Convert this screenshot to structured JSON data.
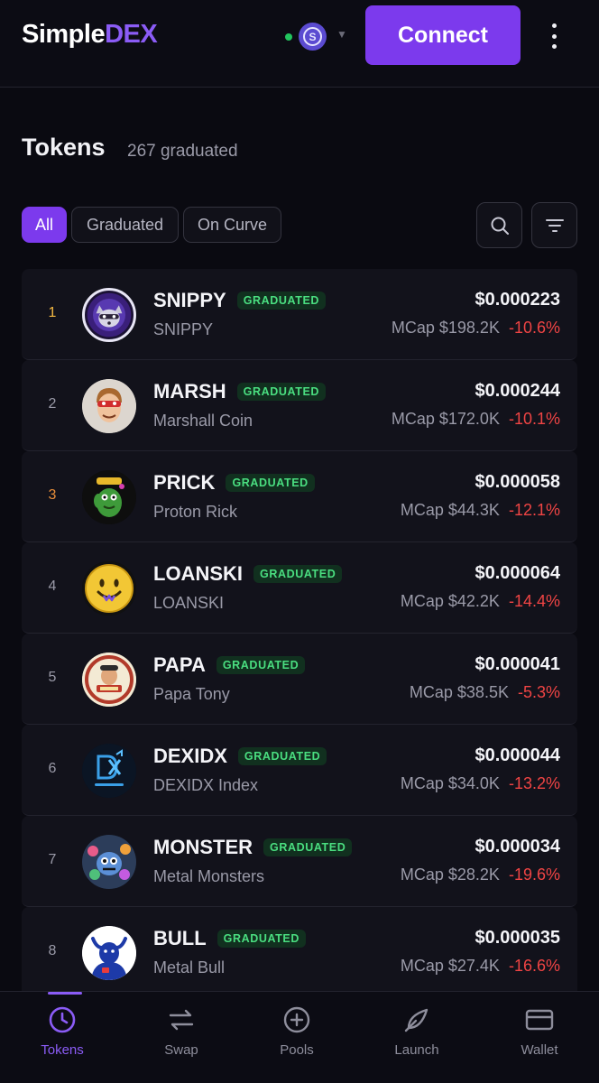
{
  "app": {
    "logo_part1": "Simple",
    "logo_part2": "DEX",
    "network_badge": "S",
    "connect_label": "Connect",
    "colors": {
      "accent": "#7c3aed",
      "positive": "#4ade80",
      "negative": "#ef4444"
    }
  },
  "page": {
    "title": "Tokens",
    "subtitle": "267 graduated"
  },
  "filters": {
    "all": "All",
    "graduated": "Graduated",
    "on_curve": "On Curve",
    "active": "All"
  },
  "tokens": [
    {
      "rank": "1",
      "symbol": "SNIPPY",
      "badge": "GRADUATED",
      "name": "SNIPPY",
      "price": "$0.000223",
      "mcap": "MCap $198.2K",
      "change": "-10.6%",
      "avatar_icon": "snippy-raccoon-avatar"
    },
    {
      "rank": "2",
      "symbol": "MARSH",
      "badge": "GRADUATED",
      "name": "Marshall Coin",
      "price": "$0.000244",
      "mcap": "MCap $172.0K",
      "change": "-10.1%",
      "avatar_icon": "marsh-masked-man-avatar"
    },
    {
      "rank": "3",
      "symbol": "PRICK",
      "badge": "GRADUATED",
      "name": "Proton Rick",
      "price": "$0.000058",
      "mcap": "MCap $44.3K",
      "change": "-12.1%",
      "avatar_icon": "prick-cactus-avatar"
    },
    {
      "rank": "4",
      "symbol": "LOANSKI",
      "badge": "GRADUATED",
      "name": "LOANSKI",
      "price": "$0.000064",
      "mcap": "MCap $42.2K",
      "change": "-14.4%",
      "avatar_icon": "loanski-smiley-avatar"
    },
    {
      "rank": "5",
      "symbol": "PAPA",
      "badge": "GRADUATED",
      "name": "Papa Tony",
      "price": "$0.000041",
      "mcap": "MCap $38.5K",
      "change": "-5.3%",
      "avatar_icon": "papa-tony-avatar"
    },
    {
      "rank": "6",
      "symbol": "DEXIDX",
      "badge": "GRADUATED",
      "name": "DEXIDX Index",
      "price": "$0.000044",
      "mcap": "MCap $34.0K",
      "change": "-13.2%",
      "avatar_icon": "dexidx-logo-avatar"
    },
    {
      "rank": "7",
      "symbol": "MONSTER",
      "badge": "GRADUATED",
      "name": "Metal Monsters",
      "price": "$0.000034",
      "mcap": "MCap $28.2K",
      "change": "-19.6%",
      "avatar_icon": "monster-avatar"
    },
    {
      "rank": "8",
      "symbol": "BULL",
      "badge": "GRADUATED",
      "name": "Metal Bull",
      "price": "$0.000035",
      "mcap": "MCap $27.4K",
      "change": "-16.6%",
      "avatar_icon": "bull-avatar"
    }
  ],
  "nav": {
    "tokens": "Tokens",
    "swap": "Swap",
    "pools": "Pools",
    "launch": "Launch",
    "wallet": "Wallet",
    "active": "Tokens"
  }
}
